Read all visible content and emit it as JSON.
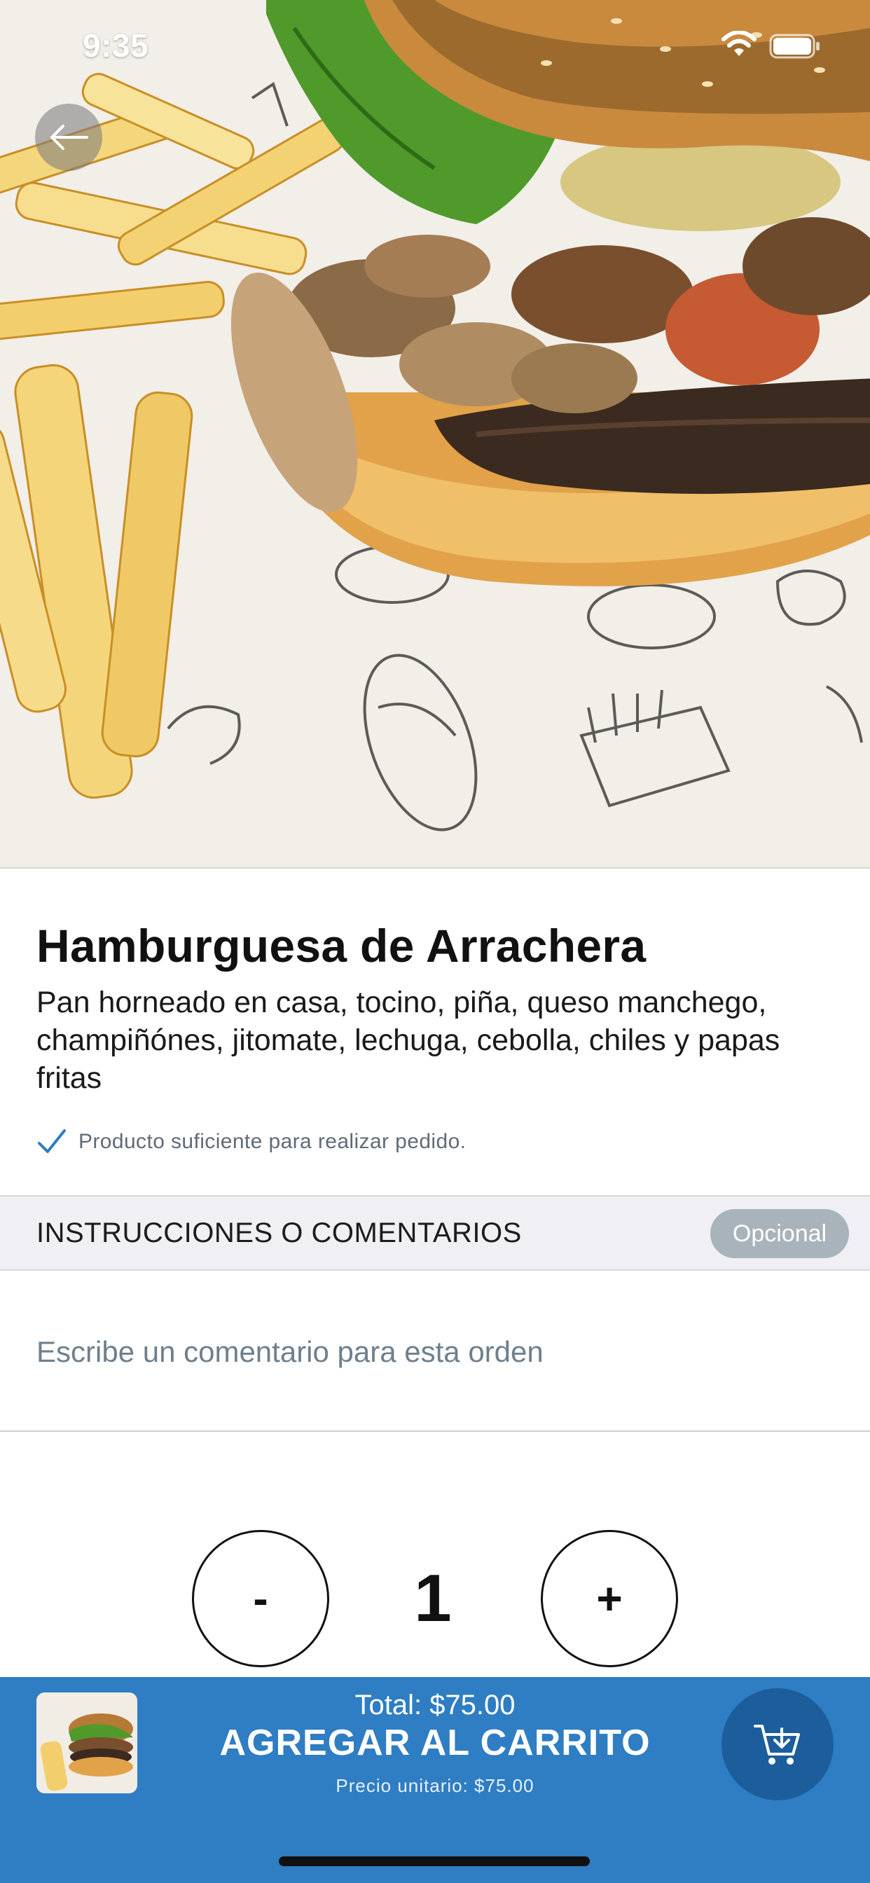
{
  "status_bar": {
    "time": "9:35"
  },
  "icons": {
    "back": "arrow-left-icon",
    "wifi": "wifi-icon",
    "battery": "battery-icon",
    "check": "checkmark-icon",
    "cart": "cart-add-icon"
  },
  "product": {
    "title": "Hamburguesa de Arrachera",
    "description": "Pan horneado en casa, tocino, piña, queso manchego, champiñónes, jitomate, lechuga, cebolla, chiles y papas fritas",
    "availability": "Producto suficiente para realizar pedido."
  },
  "comments": {
    "section_title": "INSTRUCCIONES O COMENTARIOS",
    "badge": "Opcional",
    "placeholder": "Escribe un comentario para esta orden"
  },
  "quantity": {
    "minus_label": "-",
    "value": "1",
    "plus_label": "+"
  },
  "cart_bar": {
    "total": "Total: $75.00",
    "action_label": "AGREGAR AL CARRITO",
    "unit_price": "Precio unitario: $75.00"
  },
  "colors": {
    "accent": "#2f7dc3",
    "cart_button": "#1c5e9c",
    "check": "#2f7dc3",
    "badge": "#a9b3bb",
    "section_bg": "#efeff4"
  }
}
